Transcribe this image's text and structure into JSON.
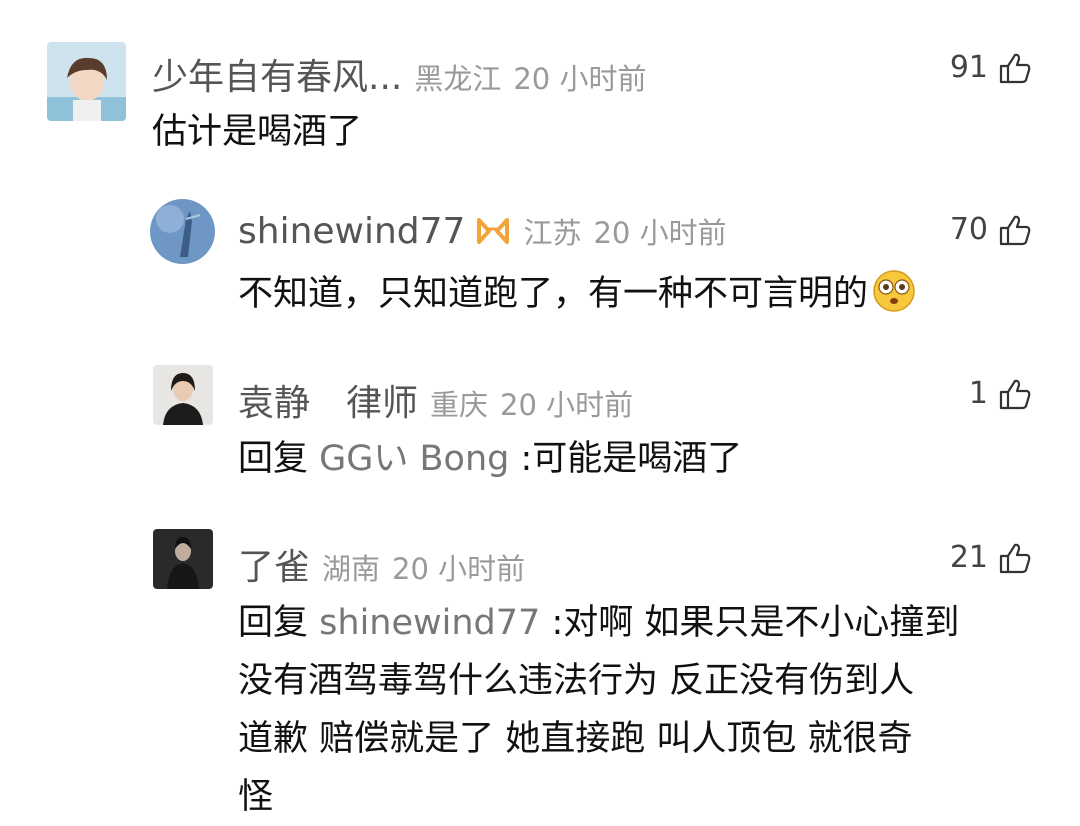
{
  "comments": [
    {
      "username": "少年自有春风...",
      "location": "黑龙江",
      "time": "20 小时前",
      "likes": "91",
      "text": "估计是喝酒了"
    },
    {
      "username": "shinewind77",
      "location": "江苏",
      "time": "20 小时前",
      "likes": "70",
      "text": "不知道，只知道跑了，有一种不可言明的",
      "badge_icon": "infinity-badge-icon",
      "emoji_icon": "flushed-face-emoji-icon"
    },
    {
      "username": "袁静　律师",
      "location": "重庆",
      "time": "20 小时前",
      "likes": "1",
      "reply_prefix": "回复",
      "reply_target": "GGい Bong",
      "text": ":可能是喝酒了"
    },
    {
      "username": "了雀",
      "location": "湖南",
      "time": "20 小时前",
      "likes": "21",
      "reply_prefix": "回复",
      "reply_target": "shinewind77",
      "text_lines": [
        ":对啊 如果只是不小心撞到",
        "没有酒驾毒驾什么违法行为 反正没有伤到人",
        "道歉 赔偿就是了 她直接跑 叫人顶包 就很奇",
        "怪"
      ]
    }
  ],
  "colors": {
    "username": "#555555",
    "meta": "#9a9a9a",
    "badge": "#f2a33a",
    "text": "#111111"
  }
}
